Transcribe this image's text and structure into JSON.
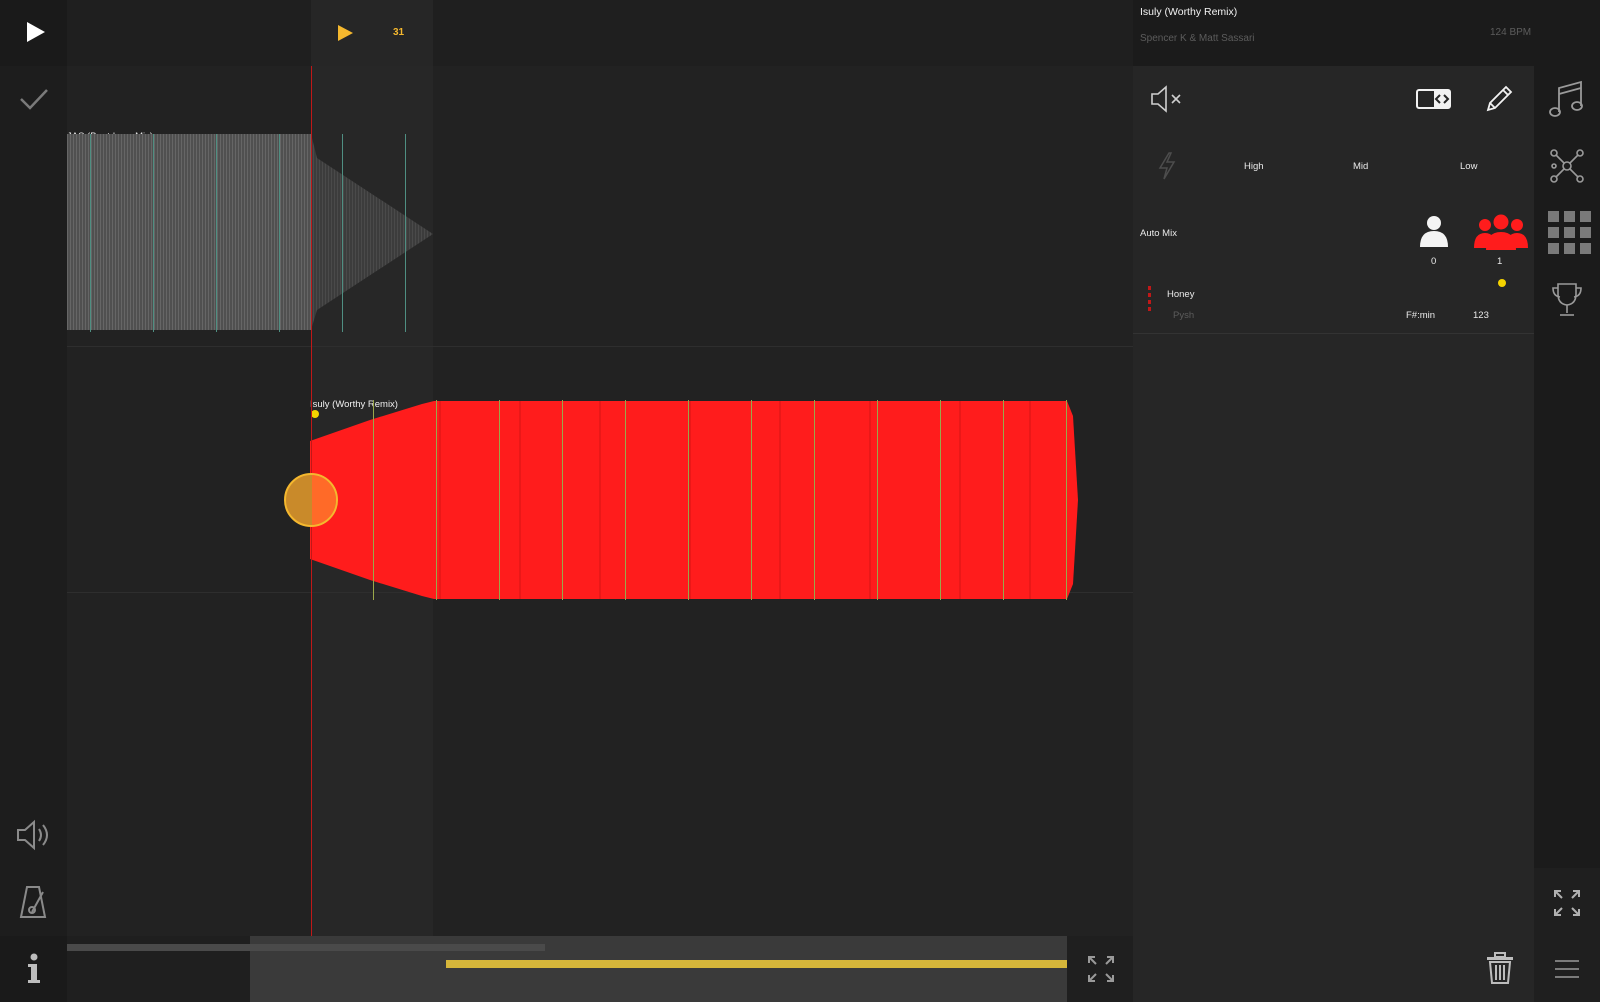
{
  "header": {
    "cue_counter": "31"
  },
  "tracks": [
    {
      "label": "JAS (Beatdown Mix)"
    },
    {
      "label": "Isuly (Worthy Remix)"
    }
  ],
  "now_playing": {
    "title": "Isuly (Worthy Remix)",
    "artist": "Spencer K & Matt Sassari",
    "bpm": "124 BPM"
  },
  "eq": {
    "high": "High",
    "mid": "Mid",
    "low": "Low"
  },
  "auto_mix": {
    "label": "Auto Mix",
    "single_count": "0",
    "crowd_count": "1"
  },
  "queue": [
    {
      "title": "Honey",
      "artist": "Pysh",
      "key": "F#:min",
      "bpm": "123"
    }
  ],
  "colors": {
    "accent_yellow": "#f5b82e",
    "waveform_red": "#ff1c1c",
    "playhead_red": "#c01818",
    "grey_wave": "#555555"
  },
  "icons": {
    "play": "play-icon",
    "cue_play": "cue-play-icon",
    "check": "check-icon",
    "volume": "volume-icon",
    "metronome": "metronome-icon",
    "info": "info-icon",
    "mute": "mute-icon",
    "swap": "swap-icon",
    "edit": "pencil-icon",
    "flash": "flash-icon",
    "music": "music-note-icon",
    "network": "network-icon",
    "grid": "grid-icon",
    "trophy": "trophy-icon",
    "expand": "expand-icon",
    "trash": "trash-icon",
    "menu": "menu-icon"
  }
}
